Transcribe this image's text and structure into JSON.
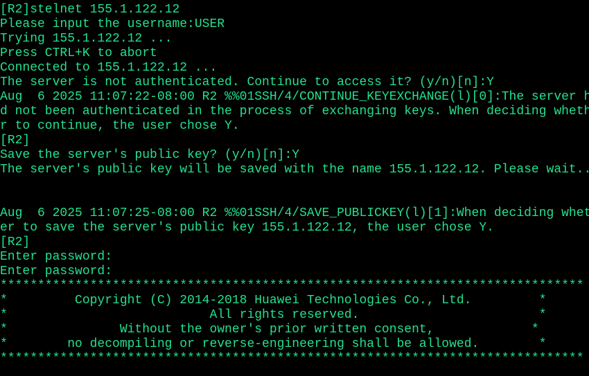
{
  "theme": {
    "background": "#000000",
    "foreground": "#24e08e"
  },
  "terminal": {
    "lines": [
      "[R2]stelnet 155.1.122.12",
      "Please input the username:USER",
      "Trying 155.1.122.12 ...",
      "Press CTRL+K to abort",
      "Connected to 155.1.122.12 ...",
      "The server is not authenticated. Continue to access it? (y/n)[n]:Y",
      "Aug  6 2025 11:07:22-08:00 R2 %%01SSH/4/CONTINUE_KEYEXCHANGE(l)[0]:The server ha",
      "d not been authenticated in the process of exchanging keys. When deciding whethe",
      "r to continue, the user chose Y.",
      "[R2]",
      "Save the server's public key? (y/n)[n]:Y",
      "The server's public key will be saved with the name 155.1.122.12. Please wait...",
      "",
      "",
      "Aug  6 2025 11:07:25-08:00 R2 %%01SSH/4/SAVE_PUBLICKEY(l)[1]:When deciding wheth",
      "er to save the server's public key 155.1.122.12, the user chose Y.",
      "[R2]",
      "Enter password:",
      "Enter password:",
      "******************************************************************************",
      "*         Copyright (C) 2014-2018 Huawei Technologies Co., Ltd.         *",
      "*                           All rights reserved.                        *",
      "*               Without the owner's prior written consent,             *",
      "*        no decompiling or reverse-engineering shall be allowed.        *",
      "******************************************************************************"
    ]
  }
}
